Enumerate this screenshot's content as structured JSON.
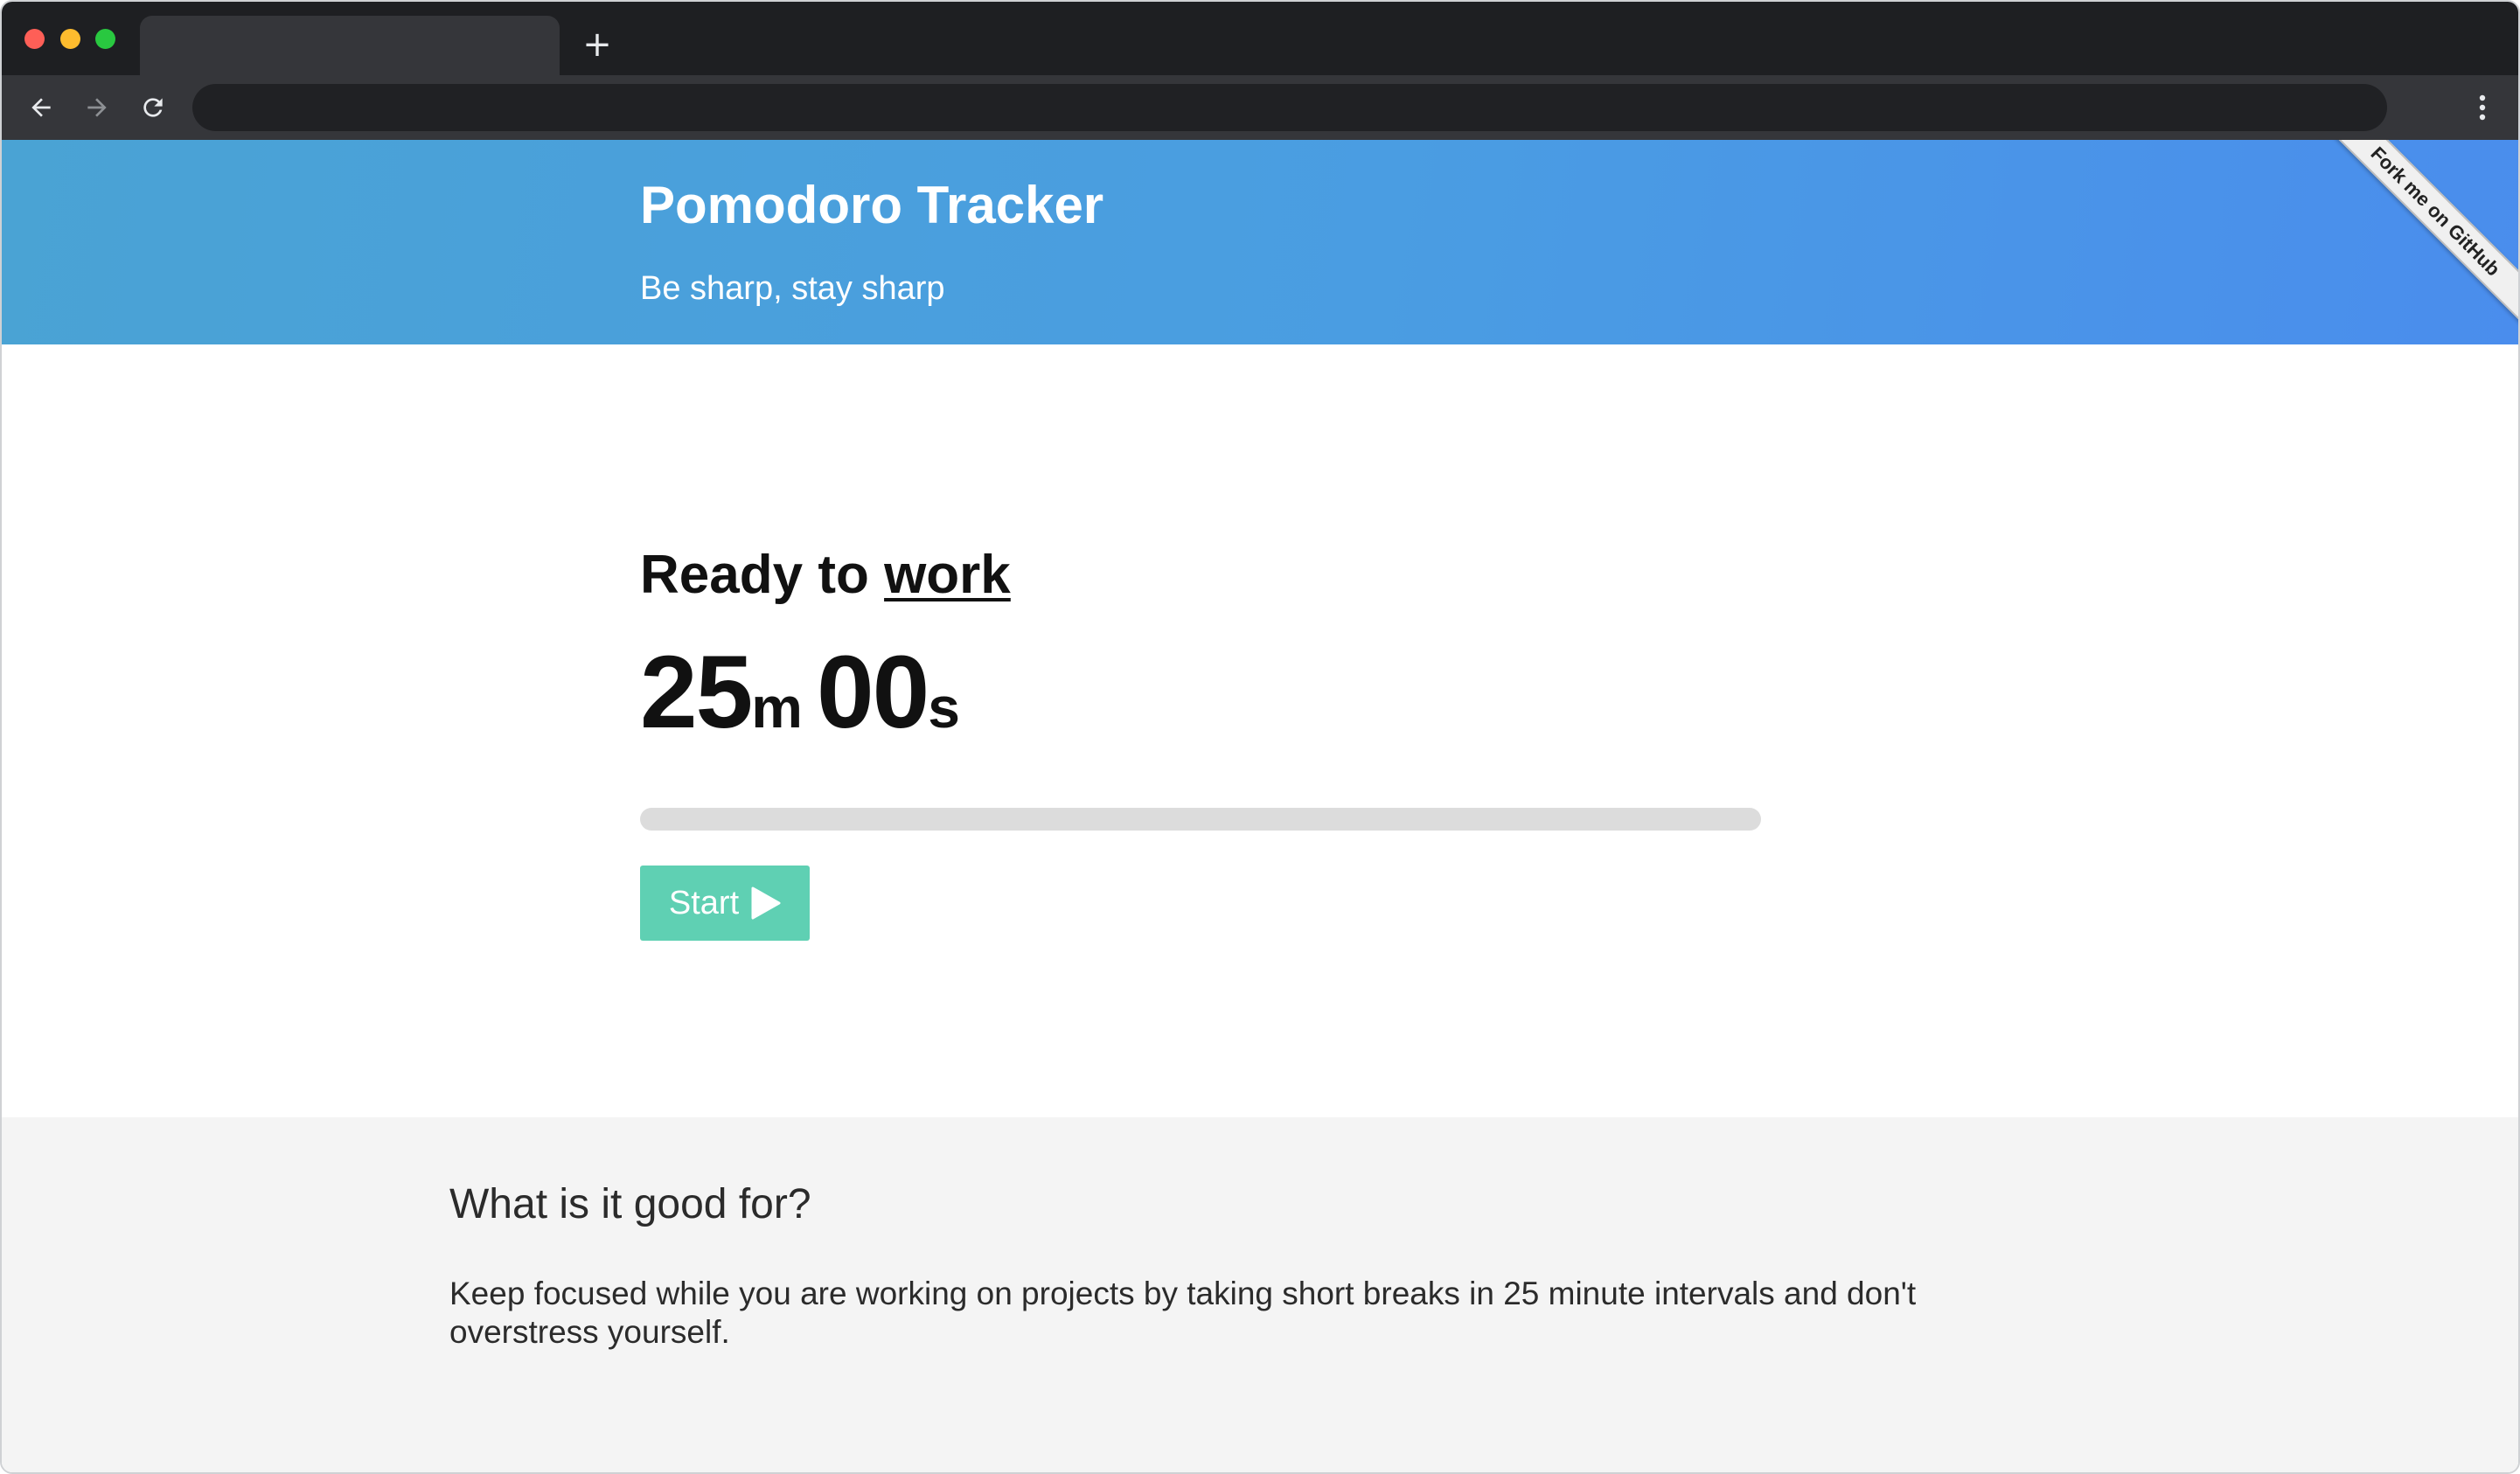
{
  "browser": {
    "tab_title": "",
    "new_tab_label": "+",
    "address": ""
  },
  "hero": {
    "title": "Pomodoro Tracker",
    "subtitle": "Be sharp, stay sharp",
    "ribbon": "Fork me on GitHub"
  },
  "timer": {
    "status_prefix": "Ready to",
    "mode": "work",
    "minutes": "25",
    "minutes_unit": "m",
    "seconds": "00",
    "seconds_unit": "s",
    "progress_percent": 0,
    "start_label": "Start"
  },
  "about": {
    "title": "What is it good for?",
    "text": "Keep focused while you are working on projects by taking short breaks in 25 minute intervals and don't overstress yourself."
  },
  "colors": {
    "hero_start": "#4aa3d4",
    "hero_end": "#4a8ded",
    "accent": "#5fd0b3",
    "progress_track": "#dcdcdc",
    "about_bg": "#f4f4f4"
  },
  "icons": {
    "back": "arrow-left-icon",
    "forward": "arrow-right-icon",
    "reload": "reload-icon",
    "menu": "more-vertical-icon",
    "start": "play-icon"
  }
}
